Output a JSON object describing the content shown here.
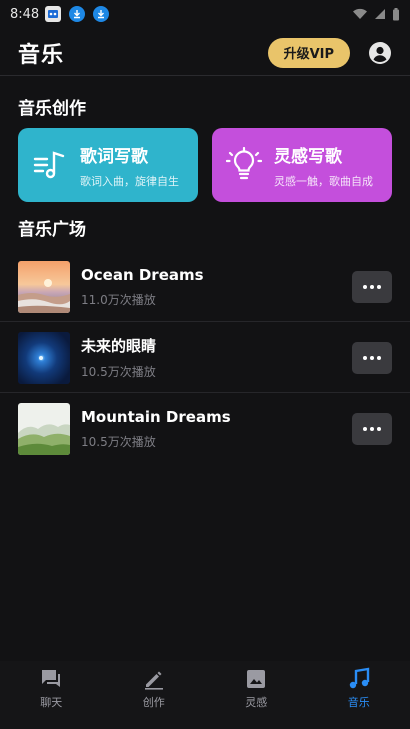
{
  "status_bar": {
    "time": "8:48"
  },
  "header": {
    "title": "音乐",
    "vip_label": "升级VIP"
  },
  "creation": {
    "section_title": "音乐创作",
    "cards": [
      {
        "title": "歌词写歌",
        "subtitle": "歌词入曲，旋律自生",
        "color": "#2fb4cc",
        "icon": "music-lyrics-icon"
      },
      {
        "title": "灵感写歌",
        "subtitle": "灵感一触，歌曲自成",
        "color": "#c44fdc",
        "icon": "lightbulb-icon"
      }
    ]
  },
  "plaza": {
    "section_title": "音乐广场",
    "songs": [
      {
        "title": "Ocean Dreams",
        "plays": "11.0万次播放",
        "thumb": "ocean-sunset"
      },
      {
        "title": "未来的眼睛",
        "plays": "10.5万次播放",
        "thumb": "blue-glow"
      },
      {
        "title": "Mountain Dreams",
        "plays": "10.5万次播放",
        "thumb": "green-mountains"
      }
    ]
  },
  "bottom_nav": {
    "items": [
      {
        "label": "聊天",
        "icon": "chat-icon"
      },
      {
        "label": "创作",
        "icon": "pencil-icon"
      },
      {
        "label": "灵感",
        "icon": "image-icon"
      },
      {
        "label": "音乐",
        "icon": "music-note-icon",
        "active": true
      }
    ]
  },
  "colors": {
    "accent": "#2a8df5",
    "vip": "#e9c46a",
    "background": "#121214"
  }
}
